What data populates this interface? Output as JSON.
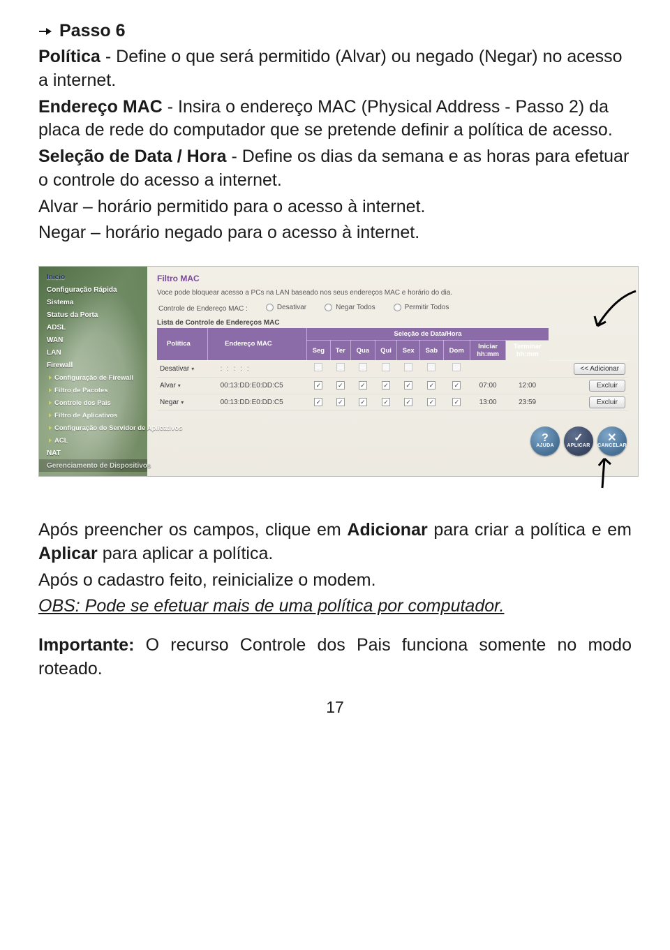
{
  "step": {
    "label": "Passo 6",
    "para1_prefix_bold": "Política",
    "para1_text": " - Define o que será permitido (Alvar) ou negado (Negar) no acesso a internet.",
    "para2_prefix_bold": "Endereço MAC",
    "para2_text": " - Insira o endereço MAC (Physical Address - Passo 2) da placa de rede do computador que se pretende definir a política de acesso.",
    "para3_prefix_bold": "Seleção de Data / Hora",
    "para3_text": " - Define os dias da semana e as horas para efetuar o controle do acesso a internet.",
    "para4": "Alvar – horário permitido para o acesso à internet.",
    "para5": "Negar – horário negado para o acesso à internet."
  },
  "screenshot": {
    "nav": [
      {
        "label": "Inicio",
        "type": "highlight"
      },
      {
        "label": "Configuração Rápida",
        "type": "main"
      },
      {
        "label": "Sistema",
        "type": "main"
      },
      {
        "label": "Status da Porta",
        "type": "main"
      },
      {
        "label": "ADSL",
        "type": "main"
      },
      {
        "label": "WAN",
        "type": "main"
      },
      {
        "label": "LAN",
        "type": "main"
      },
      {
        "label": "Firewall",
        "type": "main"
      },
      {
        "label": "Configuração de Firewall",
        "type": "sub"
      },
      {
        "label": "Filtro de Pacotes",
        "type": "sub"
      },
      {
        "label": "Controle dos Pais",
        "type": "sub"
      },
      {
        "label": "Filtro de Aplicativos",
        "type": "sub"
      },
      {
        "label": "Configuração do Servidor de Aplicativos",
        "type": "sub"
      },
      {
        "label": "ACL",
        "type": "sub"
      },
      {
        "label": "NAT",
        "type": "main"
      },
      {
        "label": "Gerenciamento de Dispositivos",
        "type": "last"
      }
    ],
    "panel": {
      "title": "Filtro MAC",
      "description": "Voce pode bloquear acesso a PCs na LAN baseado nos seus endereços MAC e horário do dia.",
      "mac_control_label": "Controle de Endereço MAC :",
      "radios": [
        "Desativar",
        "Negar Todos",
        "Permitir Todos"
      ],
      "list_title": "Lista de Controle de Endereços MAC",
      "headers": {
        "politica": "Política",
        "endereco": "Endereço MAC",
        "selecao": "Seleção de Data/Hora",
        "days": [
          "Seg",
          "Ter",
          "Qua",
          "Qui",
          "Sex",
          "Sab",
          "Dom"
        ],
        "start": "Iniciar hh:mm",
        "end": "Terminar hh:mm"
      },
      "rows": [
        {
          "policy": "Desativar",
          "mac": ":     :     :     :     :",
          "days": [
            0,
            0,
            0,
            0,
            0,
            0,
            0
          ],
          "start": "",
          "end": "",
          "action": "<< Adicionar"
        },
        {
          "policy": "Alvar",
          "mac": "00:13:DD:E0:DD:C5",
          "days": [
            1,
            1,
            1,
            1,
            1,
            1,
            1
          ],
          "start": "07:00",
          "end": "12:00",
          "action": "Excluir"
        },
        {
          "policy": "Negar",
          "mac": "00:13:DD:E0:DD:C5",
          "days": [
            1,
            1,
            1,
            1,
            1,
            1,
            1
          ],
          "start": "13:00",
          "end": "23:59",
          "action": "Excluir"
        }
      ],
      "footer_buttons": [
        "AJUDA",
        "APLICAR",
        "CANCELAR"
      ]
    }
  },
  "after": {
    "p1_a": "Após preencher os campos, clique em ",
    "p1_b": "Adicionar",
    "p1_c": " para criar a política e em ",
    "p1_d": "Aplicar",
    "p1_e": " para aplicar a política.",
    "p2": "Após o cadastro feito, reinicialize o modem.",
    "obs": "OBS: Pode se efetuar mais de uma política por computador.",
    "imp_a": "Importante:",
    "imp_b": " O recurso Controle dos Pais funciona somente no modo roteado."
  },
  "page_number": "17"
}
